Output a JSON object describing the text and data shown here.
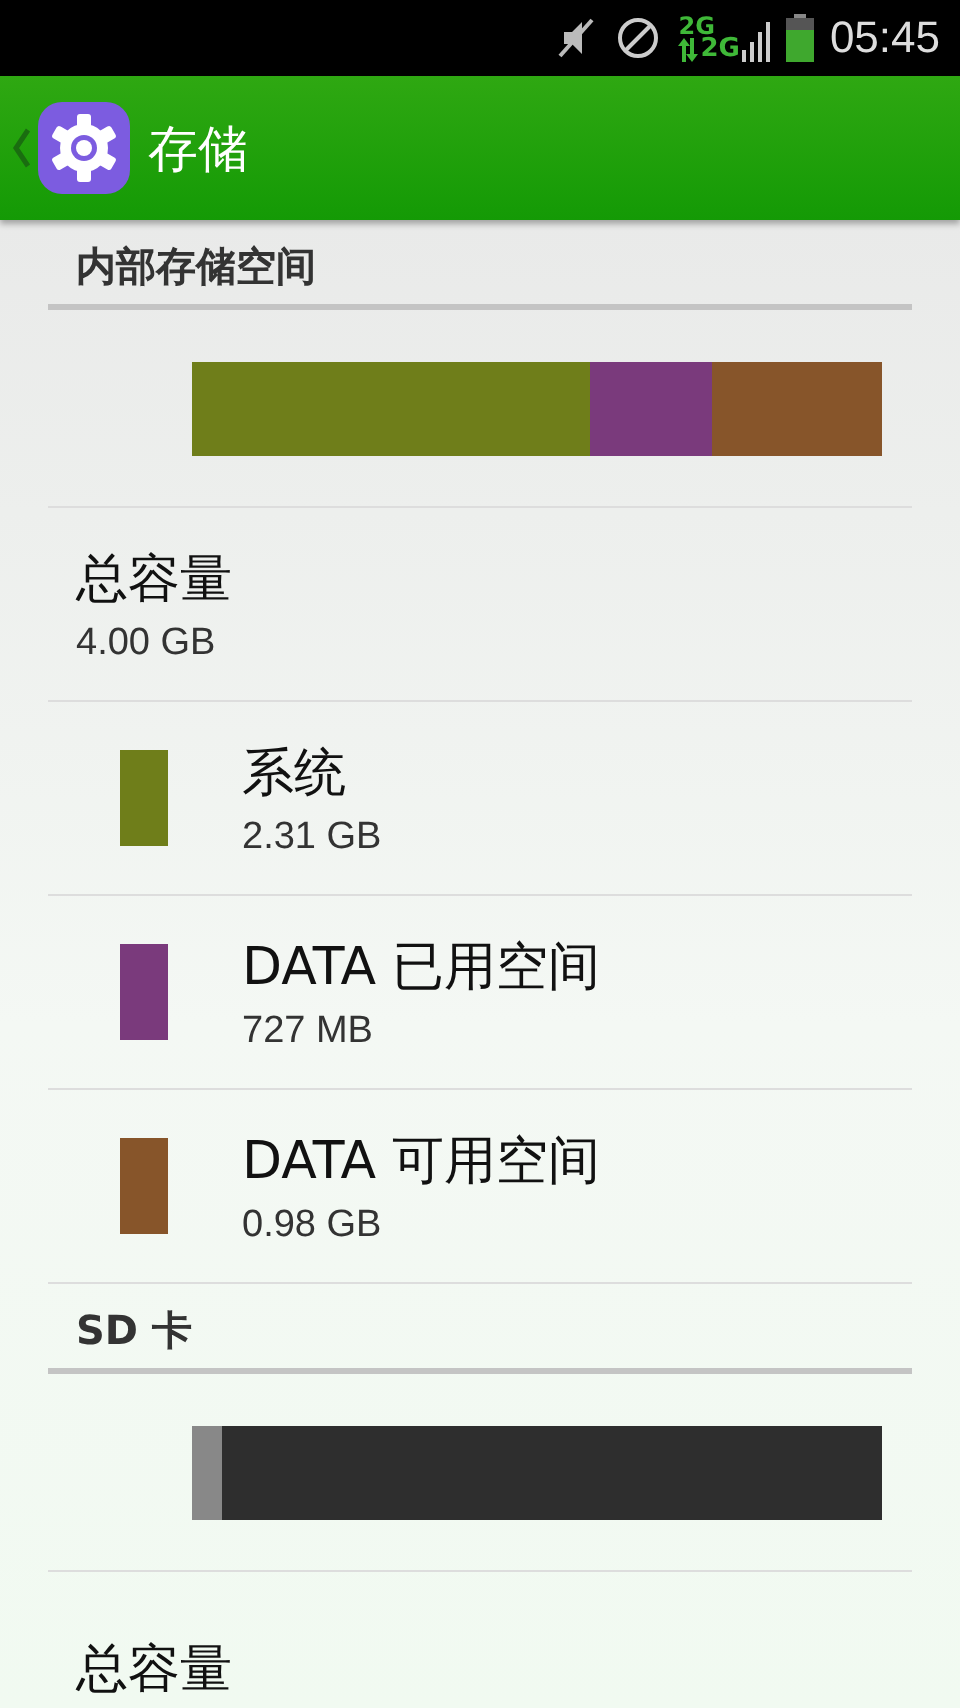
{
  "status_bar": {
    "time": "05:45",
    "network_top": "2G",
    "network_bottom": "2G"
  },
  "header": {
    "title": "存储"
  },
  "sections": [
    {
      "title": "内部存储空间",
      "segments": [
        {
          "color": "#6f7e1a"
        },
        {
          "color": "#7a3a7c"
        },
        {
          "color": "#87552a"
        }
      ],
      "total_label": "总容量",
      "total_value": "4.00 GB",
      "items": [
        {
          "label": "系统",
          "value": "2.31 GB",
          "color": "#6f7e1a"
        },
        {
          "label": "DATA 已用空间",
          "value": "727 MB",
          "color": "#7a3a7c"
        },
        {
          "label": "DATA 可用空间",
          "value": "0.98 GB",
          "color": "#87552a"
        }
      ]
    },
    {
      "title": "SD 卡",
      "segments": [
        {
          "color": "#888888"
        },
        {
          "color": "#2e2e2e"
        }
      ],
      "total_label": "总容量"
    }
  ]
}
